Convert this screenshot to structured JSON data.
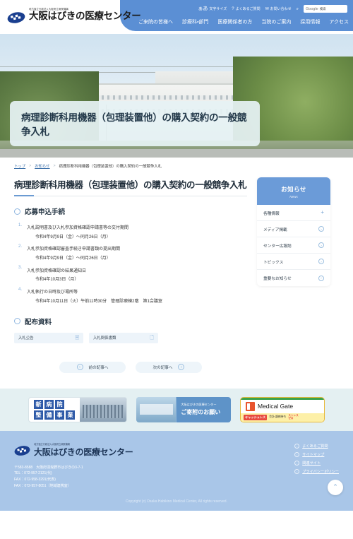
{
  "header": {
    "logo_sub": "地方独立行政法人大阪府立病院機構",
    "logo_main": "大阪はびきの医療センター",
    "utilities": [
      {
        "icon": "text-size-icon",
        "label": "文字サイズ"
      },
      {
        "icon": "question-icon",
        "label": "よくあるご質問"
      },
      {
        "icon": "mail-icon",
        "label": "お問い合わせ"
      }
    ],
    "search": {
      "icon": "search-icon",
      "brand": "Google",
      "label": "検索"
    },
    "nav": [
      "ご来院の皆様へ",
      "診療科・部門",
      "医療関係者の方",
      "当院のご案内",
      "採用情報",
      "アクセス"
    ]
  },
  "hero": {
    "title": "病理診断科用機器（包理装置他）の購入契約の一般競争入札"
  },
  "breadcrumb": {
    "items": [
      "トップ",
      "お知らせ"
    ],
    "current": "病理診断科用機器（包理装置他）の購入契約の一般競争入札"
  },
  "main": {
    "page_title": "病理診断科用機器（包理装置他）の購入契約の一般競争入札",
    "section1_title": "応募申込手続",
    "procedures": [
      {
        "no": "1.",
        "title": "入札説明書及び入札参加資格確認申請書等の交付期間",
        "detail": "令和4年9月9日（金）～同月26日（月）"
      },
      {
        "no": "2.",
        "title": "入札参加資格確認審査手続き申請書類の提出期間",
        "detail": "令和4年9月9日（金）～同月26日（月）"
      },
      {
        "no": "3.",
        "title": "入札参加資格確認の結果通知日",
        "detail": "令和4年10月3日（月）"
      },
      {
        "no": "4.",
        "title": "入札執行の日時及び場所等",
        "detail": "令和4年10月11日（火）午前11時30分　管理診療棟2階　第1会議室"
      }
    ],
    "section2_title": "配布資料",
    "downloads": [
      {
        "label": "入札公告",
        "icon": "pdf-file-icon"
      },
      {
        "label": "入札関係書類",
        "icon": "document-file-icon"
      }
    ],
    "pager": {
      "prev": "前の記事へ",
      "next": "次の記事へ",
      "prev_icon": "chevron-left-icon",
      "next_icon": "chevron-right-icon"
    }
  },
  "sidebar": {
    "title_jp": "お知らせ",
    "title_en": "News",
    "items": [
      {
        "label": "各種情報",
        "icon": "plus-icon"
      },
      {
        "label": "メディア掲載",
        "icon": "chevron-right-circle-icon"
      },
      {
        "label": "センター広報誌",
        "icon": "chevron-right-circle-icon"
      },
      {
        "label": "トピックス",
        "icon": "chevron-right-circle-icon"
      },
      {
        "label": "重要なお知らせ",
        "icon": "chevron-right-circle-icon"
      }
    ]
  },
  "banners": {
    "banner1": {
      "chars": [
        "新",
        "病",
        "院",
        "整",
        "備",
        "事",
        "業"
      ]
    },
    "banner2": {
      "line1": "大阪はびきの医療センター",
      "line2": "ご寄附のお願い"
    },
    "banner3": {
      "title": "Medical Gate",
      "tag": "キャッシュレス",
      "mid": "会計・調剤待ち",
      "stress1": "ストレス",
      "stress2": "ゼロ"
    }
  },
  "footer": {
    "logo_sub": "地方独立行政法人大阪府立病院機構",
    "logo_main": "大阪はびきの医療センター",
    "address": [
      "〒583-8588　大阪府羽曳野市はびきの3-7-1",
      "TEL：072-957-2121(代)",
      "FAX：072-958-3291(代表)",
      "FAX：072-957-8051（地域連携室）"
    ],
    "links": [
      "よくあるご質問",
      "サイトマップ",
      "関連サイト",
      "プライバシーポリシー"
    ],
    "copyright": "Copyright (c) Osaka Habikino Medical Center, All rights reserved.",
    "to_top_icon": "chevron-up-icon"
  },
  "colors": {
    "brand_blue": "#5b8fd4",
    "footer_blue": "#a9c6e8",
    "banner_bg": "#e4f0f2",
    "accent": "#6b9bd8"
  }
}
